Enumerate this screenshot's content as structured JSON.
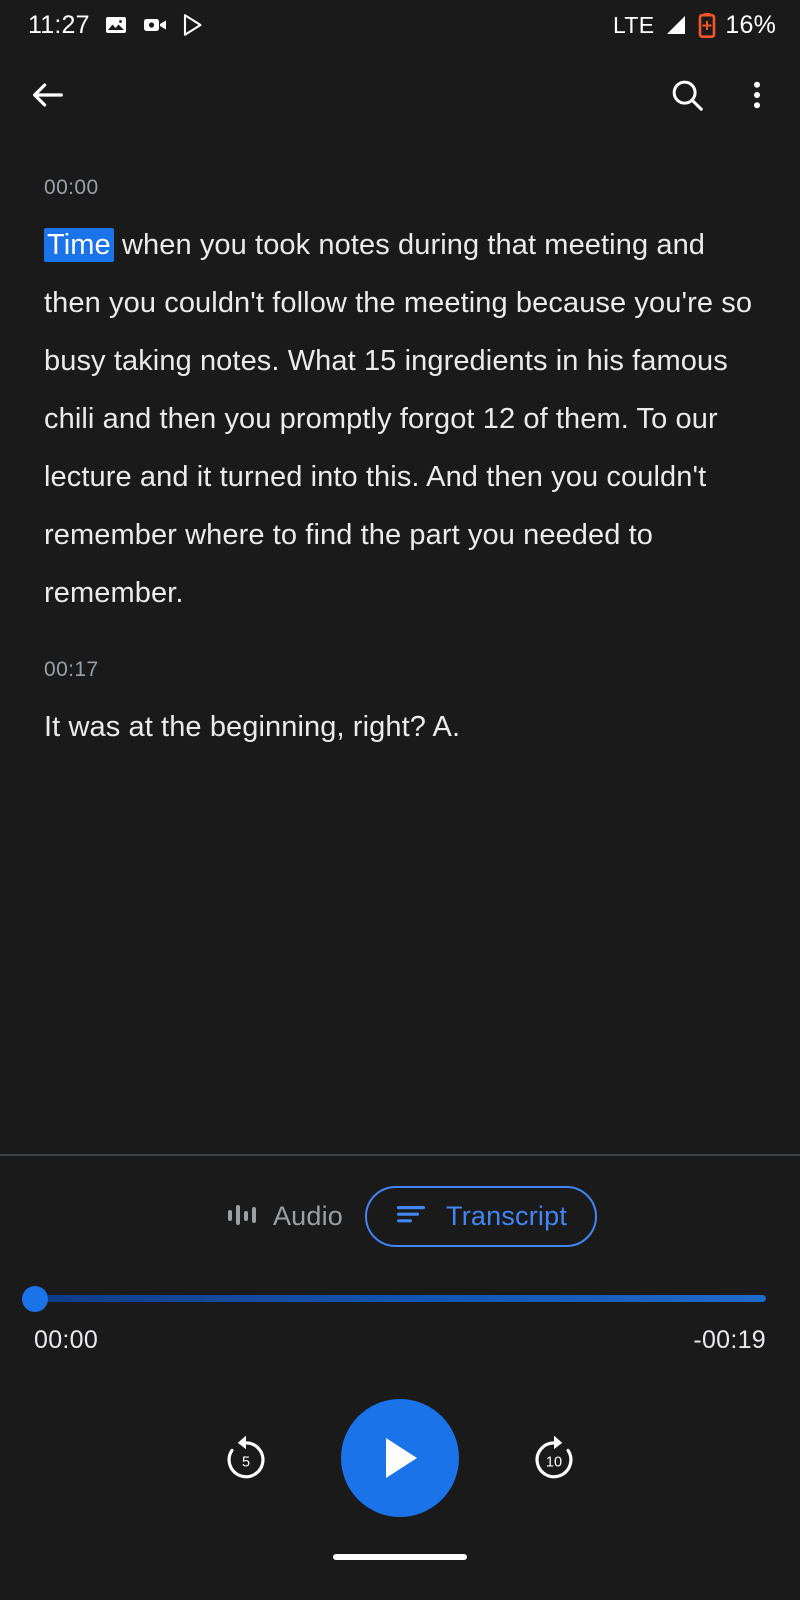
{
  "status_bar": {
    "clock": "11:27",
    "network_label": "LTE",
    "battery_percent": "16%",
    "icons": {
      "photo": "photo-icon",
      "video_camera": "video-camera-icon",
      "play_store": "play-store-icon",
      "signal": "signal-bars-icon",
      "battery": "battery-charging-icon"
    },
    "colors": {
      "battery": "#f4552b",
      "text": "#ffffff"
    }
  },
  "app_bar": {
    "back": "back-arrow-icon",
    "search": "search-icon",
    "overflow": "more-vertical-icon"
  },
  "transcript": {
    "segments": [
      {
        "time": "00:00",
        "highlight": "Time",
        "text": " when you took notes during that meeting and then you couldn't follow the meeting because you're so busy taking notes. What 15 ingredients in his famous chili and then you promptly forgot 12 of them. To our lecture and it turned into this. And then you couldn't remember where to find the part you needed to remember."
      },
      {
        "time": "00:17",
        "highlight": "",
        "text": "It was at the beginning, right? A."
      }
    ]
  },
  "player": {
    "tabs": {
      "audio_label": "Audio",
      "transcript_label": "Transcript",
      "selected": "Transcript"
    },
    "progress": {
      "position": "00:00",
      "remaining": "-00:19",
      "percent": 0
    },
    "controls": {
      "rewind_seconds": "5",
      "forward_seconds": "10",
      "play_state": "paused",
      "play_label": "play-icon"
    },
    "colors": {
      "accent": "#1a73e8",
      "tab_accent": "#4285f4",
      "muted": "#9aa0a6"
    }
  }
}
